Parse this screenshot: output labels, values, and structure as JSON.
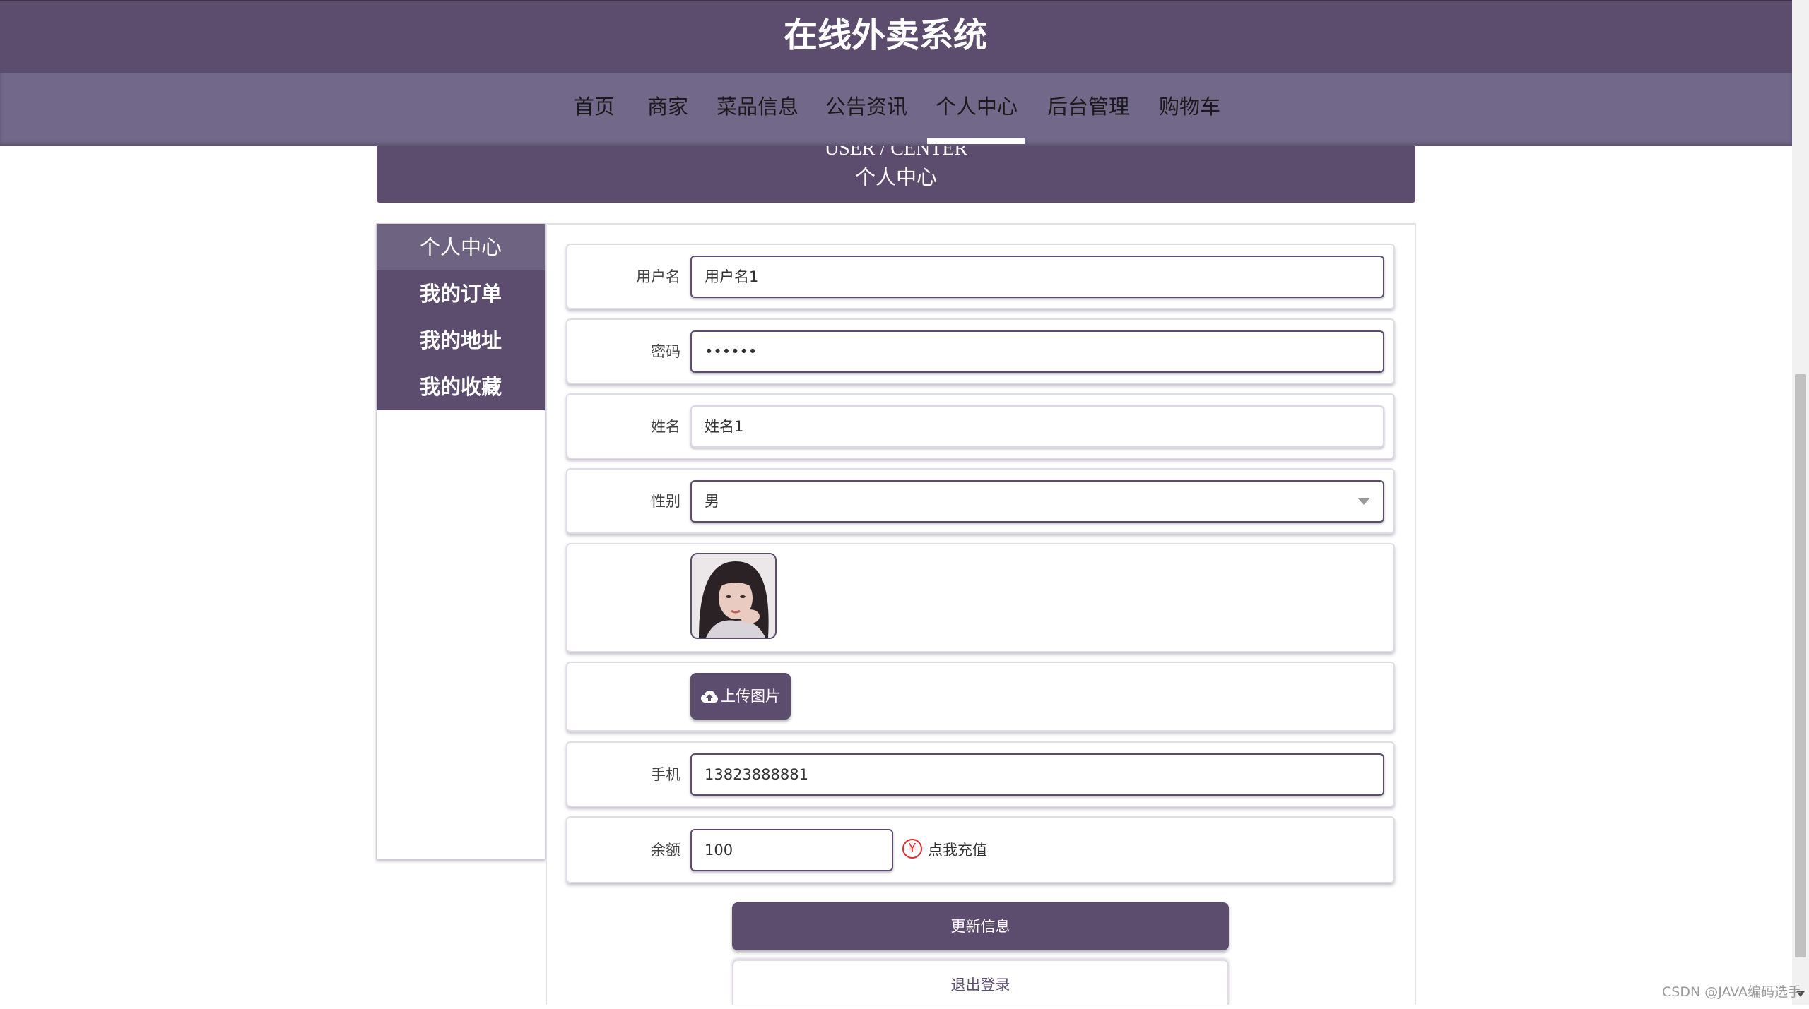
{
  "header": {
    "title": "在线外卖系统"
  },
  "nav": {
    "items": [
      "首页",
      "商家",
      "菜品信息",
      "公告资讯",
      "个人中心",
      "后台管理",
      "购物车"
    ],
    "active": "个人中心"
  },
  "banner": {
    "english": "USER / CENTER",
    "chinese": "个人中心"
  },
  "sidebar": {
    "items": [
      "个人中心",
      "我的订单",
      "我的地址",
      "我的收藏"
    ],
    "active": "个人中心"
  },
  "form": {
    "username": {
      "label": "用户名",
      "value": "用户名1"
    },
    "password": {
      "label": "密码",
      "value": "••••••"
    },
    "name": {
      "label": "姓名",
      "value": "姓名1"
    },
    "gender": {
      "label": "性别",
      "value": "男"
    },
    "upload": {
      "label": "上传图片"
    },
    "phone": {
      "label": "手机",
      "value": "13823888881"
    },
    "balance": {
      "label": "余额",
      "value": "100",
      "recharge_label": "点我充值"
    }
  },
  "actions": {
    "update": "更新信息",
    "logout": "退出登录"
  },
  "watermark": "CSDN @JAVA编码选手",
  "colors": {
    "primary": "#5c4d6e",
    "nav": "#72688a",
    "recharge_icon": "#e02a2a"
  }
}
